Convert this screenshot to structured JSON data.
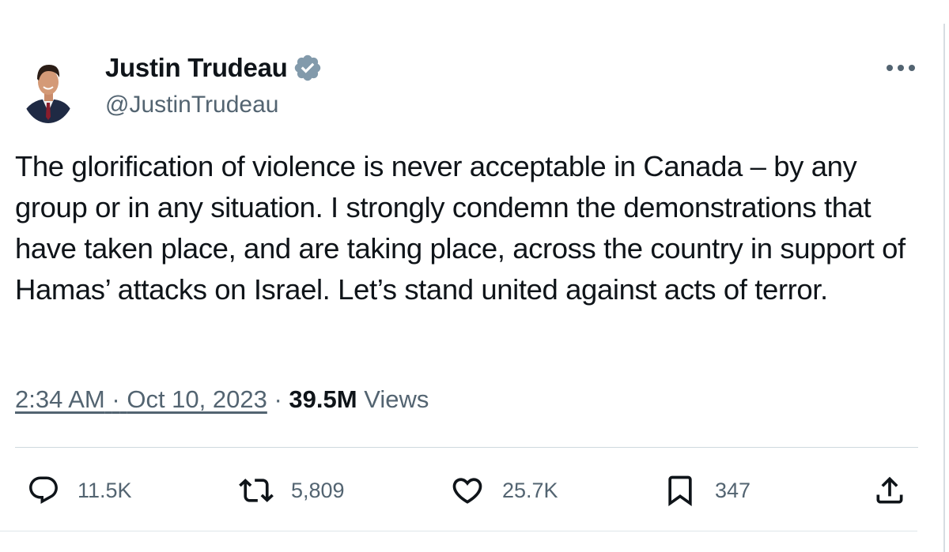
{
  "author": {
    "name": "Justin Trudeau",
    "handle": "@JustinTrudeau",
    "verified_icon": "verified-badge-icon"
  },
  "tweet": {
    "text": "The glorification of violence is never acceptable in Canada – by any group or in any situation. I strongly condemn the demonstrations that have taken place, and are taking place, across the country in support of Hamas’ attacks on Israel. Let’s stand united against acts of terror.",
    "time": "2:34 AM",
    "separator": "·",
    "date": "Oct 10, 2023",
    "views_count": "39.5M",
    "views_label": "Views"
  },
  "actions": {
    "replies": "11.5K",
    "reposts": "5,809",
    "likes": "25.7K",
    "bookmarks": "347"
  },
  "colors": {
    "text": "#0f1419",
    "secondary": "#536471",
    "divider": "#cfd9de",
    "verified": "#829aab"
  }
}
